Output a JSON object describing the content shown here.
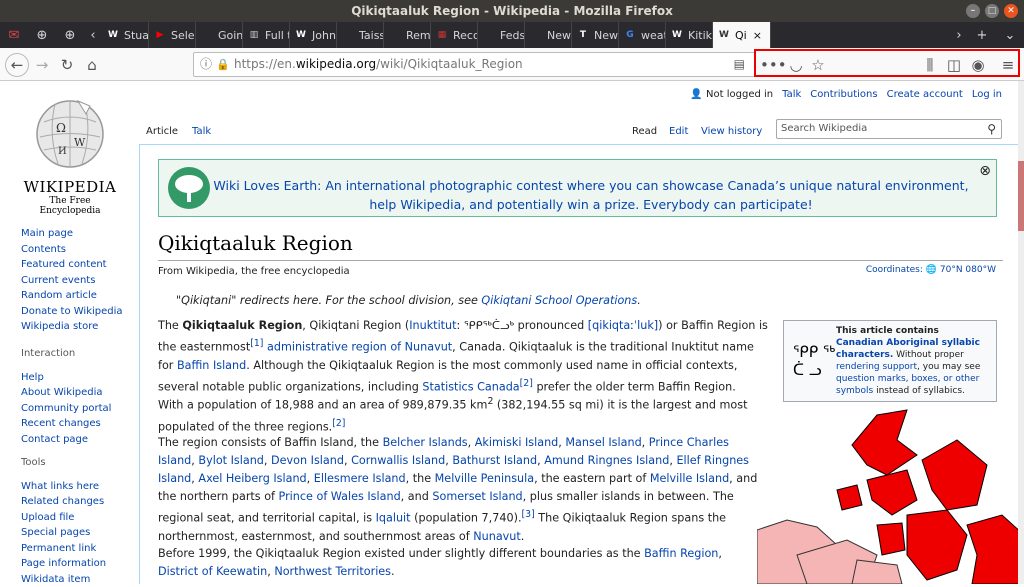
{
  "window": {
    "title": "Qikiqtaaluk Region - Wikipedia - Mozilla Firefox"
  },
  "tabs": [
    {
      "label": "Stua",
      "fav": "W"
    },
    {
      "label": "Sele",
      "fav": "▶"
    },
    {
      "label": "Goin",
      "fav": ""
    },
    {
      "label": "Full t",
      "fav": "▥"
    },
    {
      "label": "John",
      "fav": "W"
    },
    {
      "label": "Taissum",
      "fav": ""
    },
    {
      "label": "Rememl",
      "fav": ""
    },
    {
      "label": "Reco",
      "fav": "▦"
    },
    {
      "label": "Feds ren",
      "fav": ""
    },
    {
      "label": "New boo",
      "fav": ""
    },
    {
      "label": "New",
      "fav": "T"
    },
    {
      "label": "weat",
      "fav": "G"
    },
    {
      "label": "Kitik",
      "fav": "W"
    },
    {
      "label": "Qi",
      "fav": "W"
    }
  ],
  "url": {
    "scheme": "https://en.",
    "domain": "wikipedia.org",
    "path": "/wiki/Qikiqtaaluk_Region"
  },
  "logo": {
    "wordmark": "WIKIPEDIA",
    "tagline": "The Free Encyclopedia"
  },
  "sidebar": {
    "main": [
      "Main page",
      "Contents",
      "Featured content",
      "Current events",
      "Random article",
      "Donate to Wikipedia",
      "Wikipedia store"
    ],
    "interaction_head": "Interaction",
    "interaction": [
      "Help",
      "About Wikipedia",
      "Community portal",
      "Recent changes",
      "Contact page"
    ],
    "tools_head": "Tools",
    "tools": [
      "What links here",
      "Related changes",
      "Upload file",
      "Special pages",
      "Permanent link",
      "Page information",
      "Wikidata item"
    ]
  },
  "personal": {
    "not_logged": "Not logged in",
    "talk": "Talk",
    "contributions": "Contributions",
    "create": "Create account",
    "login": "Log in"
  },
  "page_tabs": {
    "article": "Article",
    "talk": "Talk",
    "read": "Read",
    "edit": "Edit",
    "history": "View history"
  },
  "search": {
    "placeholder": "Search Wikipedia"
  },
  "banner": {
    "text": "Wiki Loves Earth: An international photographic contest where you can showcase Canada’s unique natural environment, help Wikipedia, and potentially win a prize. Everybody can participate!"
  },
  "article": {
    "title": "Qikiqtaaluk Region",
    "from": "From Wikipedia, the free encyclopedia",
    "coords_label": "Coordinates:",
    "coords_value": "70°N 080°W",
    "hatnote_pre": "\"Qikiqtani\" redirects here. For the school division, see ",
    "hatnote_link": "Qikiqtani School Operations",
    "hatnote_post": ".",
    "p1": {
      "a": "The ",
      "b": "Qikiqtaaluk Region",
      "c": ", Qikiqtani Region (",
      "d": "Inuktitut",
      "e": ": ᕿᑭᖅᑖᓗᒃ pronounced ",
      "f": "[qikiqtaːˈluk]",
      "g": ") or Baffin Region is the easternmost",
      "h": "[1]",
      "i": " ",
      "j": "administrative region of Nunavut",
      "k": ", Canada. Qikiqtaaluk is the traditional Inuktitut name for ",
      "l": "Baffin Island",
      "m": ". Although the Qikiqtaaluk Region is the most commonly used name in official contexts, several notable public organizations, including ",
      "n": "Statistics Canada",
      "o": "[2]",
      "p": " prefer the older term Baffin Region."
    },
    "p2": {
      "a": "With a population of 18,988 and an area of 989,879.35 km",
      "b": "2",
      "c": " (382,194.55 sq mi) it is the largest and most populated of the three regions.",
      "d": "[2]"
    },
    "p3": {
      "a": "The region consists of Baffin Island, the ",
      "b": "Belcher Islands",
      "c": ", ",
      "d": "Akimiski Island",
      "e": ", ",
      "f": "Mansel Island",
      "g": ", ",
      "h": "Prince Charles Island",
      "i": ", ",
      "j": "Bylot Island",
      "k": ", ",
      "l": "Devon Island",
      "m": ", ",
      "n": "Cornwallis Island",
      "o": ", ",
      "p": "Bathurst Island",
      "q": ", ",
      "r": "Amund Ringnes Island",
      "s": ", ",
      "t": "Ellef Ringnes Island",
      "u": ", ",
      "v": "Axel Heiberg Island",
      "w": ", ",
      "x": "Ellesmere Island",
      "y": ", the ",
      "z": "Melville Peninsula",
      "aa": ", the eastern part of ",
      "ab": "Melville Island",
      "ac": ", and the northern parts of ",
      "ad": "Prince of Wales Island",
      "ae": ", and ",
      "af": "Somerset Island",
      "ag": ", plus smaller islands in between. The regional seat, and territorial capital, is ",
      "ah": "Iqaluit",
      "ai": " (population 7,740).",
      "aj": "[3]",
      "ak": " The Qikiqtaaluk Region spans the northernmost, easternmost, and southernmost areas of ",
      "al": "Nunavut",
      "am": "."
    },
    "p4": {
      "a": "Before 1999, the Qikiqtaaluk Region existed under slightly different boundaries as the ",
      "b": "Baffin Region",
      "c": ", ",
      "d": "District of Keewatin",
      "e": ", ",
      "f": "Northwest Territories",
      "g": "."
    }
  },
  "infobox": {
    "glyphs": "ᕿᑭ ᖅ\nᑖ ᓗ",
    "title": "This article contains",
    "link": "Canadian Aboriginal syllabic characters.",
    "t1": " Without proper ",
    "l2": "rendering support",
    "t2": ", you may see ",
    "l3": "question marks, boxes, or other symbols",
    "t3": " instead of syllabics."
  }
}
